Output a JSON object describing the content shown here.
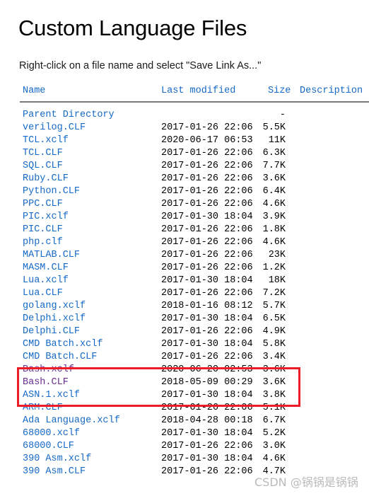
{
  "page": {
    "title": "Custom Language Files",
    "instruction": "Right-click on a file name and select \"Save Link As...\""
  },
  "listing": {
    "columns": {
      "name": "Name",
      "last_modified": "Last modified",
      "size": "Size",
      "description": "Description"
    },
    "rows": [
      {
        "name": "Parent Directory",
        "modified": "",
        "size": "-",
        "state": "link"
      },
      {
        "name": "verilog.CLF",
        "modified": "2017-01-26 22:06",
        "size": "5.5K",
        "state": "link"
      },
      {
        "name": "TCL.xclf",
        "modified": "2020-06-17 06:53",
        "size": "11K",
        "state": "link"
      },
      {
        "name": "TCL.CLF",
        "modified": "2017-01-26 22:06",
        "size": "6.3K",
        "state": "link"
      },
      {
        "name": "SQL.CLF",
        "modified": "2017-01-26 22:06",
        "size": "7.7K",
        "state": "link"
      },
      {
        "name": "Ruby.CLF",
        "modified": "2017-01-26 22:06",
        "size": "3.6K",
        "state": "link"
      },
      {
        "name": "Python.CLF",
        "modified": "2017-01-26 22:06",
        "size": "6.4K",
        "state": "link"
      },
      {
        "name": "PPC.CLF",
        "modified": "2017-01-26 22:06",
        "size": "4.6K",
        "state": "link"
      },
      {
        "name": "PIC.xclf",
        "modified": "2017-01-30 18:04",
        "size": "3.9K",
        "state": "link"
      },
      {
        "name": "PIC.CLF",
        "modified": "2017-01-26 22:06",
        "size": "1.8K",
        "state": "link"
      },
      {
        "name": "php.clf",
        "modified": "2017-01-26 22:06",
        "size": "4.6K",
        "state": "link"
      },
      {
        "name": "MATLAB.CLF",
        "modified": "2017-01-26 22:06",
        "size": "23K",
        "state": "link"
      },
      {
        "name": "MASM.CLF",
        "modified": "2017-01-26 22:06",
        "size": "1.2K",
        "state": "link"
      },
      {
        "name": "Lua.xclf",
        "modified": "2017-01-30 18:04",
        "size": "18K",
        "state": "link"
      },
      {
        "name": "Lua.CLF",
        "modified": "2017-01-26 22:06",
        "size": "7.2K",
        "state": "link"
      },
      {
        "name": "golang.xclf",
        "modified": "2018-01-16 08:12",
        "size": "5.7K",
        "state": "link"
      },
      {
        "name": "Delphi.xclf",
        "modified": "2017-01-30 18:04",
        "size": "6.5K",
        "state": "link"
      },
      {
        "name": "Delphi.CLF",
        "modified": "2017-01-26 22:06",
        "size": "4.9K",
        "state": "link"
      },
      {
        "name": "CMD Batch.xclf",
        "modified": "2017-01-30 18:04",
        "size": "5.8K",
        "state": "link"
      },
      {
        "name": "CMD Batch.CLF",
        "modified": "2017-01-26 22:06",
        "size": "3.4K",
        "state": "link"
      },
      {
        "name": "Bash.xclf",
        "modified": "2020-06-20 02:53",
        "size": "3.6K",
        "state": "visited"
      },
      {
        "name": "Bash.CLF",
        "modified": "2018-05-09 00:29",
        "size": "3.6K",
        "state": "visited"
      },
      {
        "name": "ASN.1.xclf",
        "modified": "2017-01-30 18:04",
        "size": "3.8K",
        "state": "link"
      },
      {
        "name": "ARM.CLF",
        "modified": "2017-01-26 22:06",
        "size": "5.1K",
        "state": "link"
      },
      {
        "name": "Ada Language.xclf",
        "modified": "2018-04-28 00:18",
        "size": "6.7K",
        "state": "link"
      },
      {
        "name": "68000.xclf",
        "modified": "2017-01-30 18:04",
        "size": "5.2K",
        "state": "link"
      },
      {
        "name": "68000.CLF",
        "modified": "2017-01-26 22:06",
        "size": "3.0K",
        "state": "link"
      },
      {
        "name": "390 Asm.xclf",
        "modified": "2017-01-30 18:04",
        "size": "4.6K",
        "state": "link"
      },
      {
        "name": "390 Asm.CLF",
        "modified": "2017-01-26 22:06",
        "size": "4.7K",
        "state": "link"
      }
    ]
  },
  "annotation": {
    "highlight_color": "#ee1c25",
    "highlighted_rows": [
      "Bash.xclf",
      "Bash.CLF"
    ]
  },
  "watermark": {
    "text": "CSDN @锅锅是锅锅"
  },
  "colors": {
    "link": "#1569c7",
    "visited": "#6a2d8f",
    "rule": "#7a7a7a",
    "text": "#000000"
  }
}
